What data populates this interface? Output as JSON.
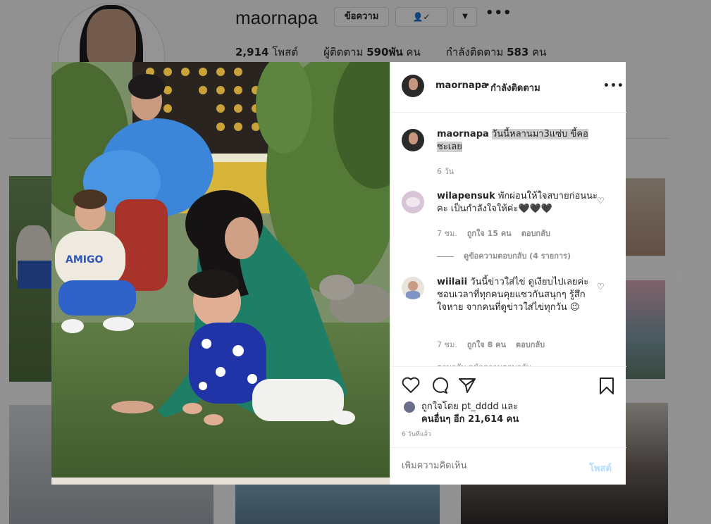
{
  "profile": {
    "username": "maornapa",
    "message_button": "ข้อความ",
    "following_button_icon": "👤✓",
    "dropdown_icon": "▼",
    "more_icon": "•••",
    "stats": {
      "posts_count": "2,914",
      "posts_label": "โพสต์",
      "followers_label": "ผู้ติดตาม",
      "followers_count": "590พัน",
      "followers_unit": "คน",
      "following_label": "กำลังติดตาม",
      "following_count": "583",
      "following_unit": "คน"
    },
    "next_arrow": "›"
  },
  "post": {
    "header": {
      "username": "maornapa",
      "separator": "•",
      "follow_status": "กำลังติดตาม",
      "more_icon": "•••"
    },
    "caption": {
      "username": "maornapa",
      "text": "วันนี้หลานมา3แซ่บ ขี้คอชะเลย",
      "time": "6 วัน"
    },
    "comments": [
      {
        "username": "wilapensuk",
        "text": "พักผ่อนให้ใจสบายก่อนนะคะ เป็นกำลังใจให้ค่ะ🖤🖤🖤",
        "time": "7 ชม.",
        "likes": "ถูกใจ 15 คน",
        "reply": "ตอบกลับ",
        "view_replies": "ดูข้อความตอบกลับ (4 รายการ)"
      },
      {
        "username": "wiilaii",
        "text": "วันนี้ข่าวใส่ไข่ ดูเงียบไปเลยค่ะ ชอบเวลาที่ทุกคนคุยแซวกันสนุกๆ รู้สึกใจหาย จากคนที่ดูข่าวใส่ไข่ทุกวัน 😉",
        "time": "7 ชม.",
        "likes": "ถูกใจ 8 คน",
        "reply": "ตอบกลับ"
      }
    ],
    "cut_off_text": "ตอบกลับ ดูข้อความตอบกลับ",
    "liked_by_prefix": "ถูกใจโดย",
    "liked_by_user": "pt_dddd",
    "liked_by_and": "และ",
    "liked_by_others": "คนอื่นๆ อีก 21,614 คน",
    "time_ago": "6 วันที่แล้ว",
    "comment_placeholder": "เพิ่มความคิดเห็น",
    "post_button": "โพสต์",
    "icons": {
      "like": "heart-icon",
      "comment": "comment-icon",
      "share": "share-icon",
      "save": "bookmark-icon"
    }
  },
  "colors": {
    "link_disabled": "#b3dbff",
    "muted_text": "#8e8e8e",
    "overlay": "rgba(0,0,0,0.42)"
  }
}
